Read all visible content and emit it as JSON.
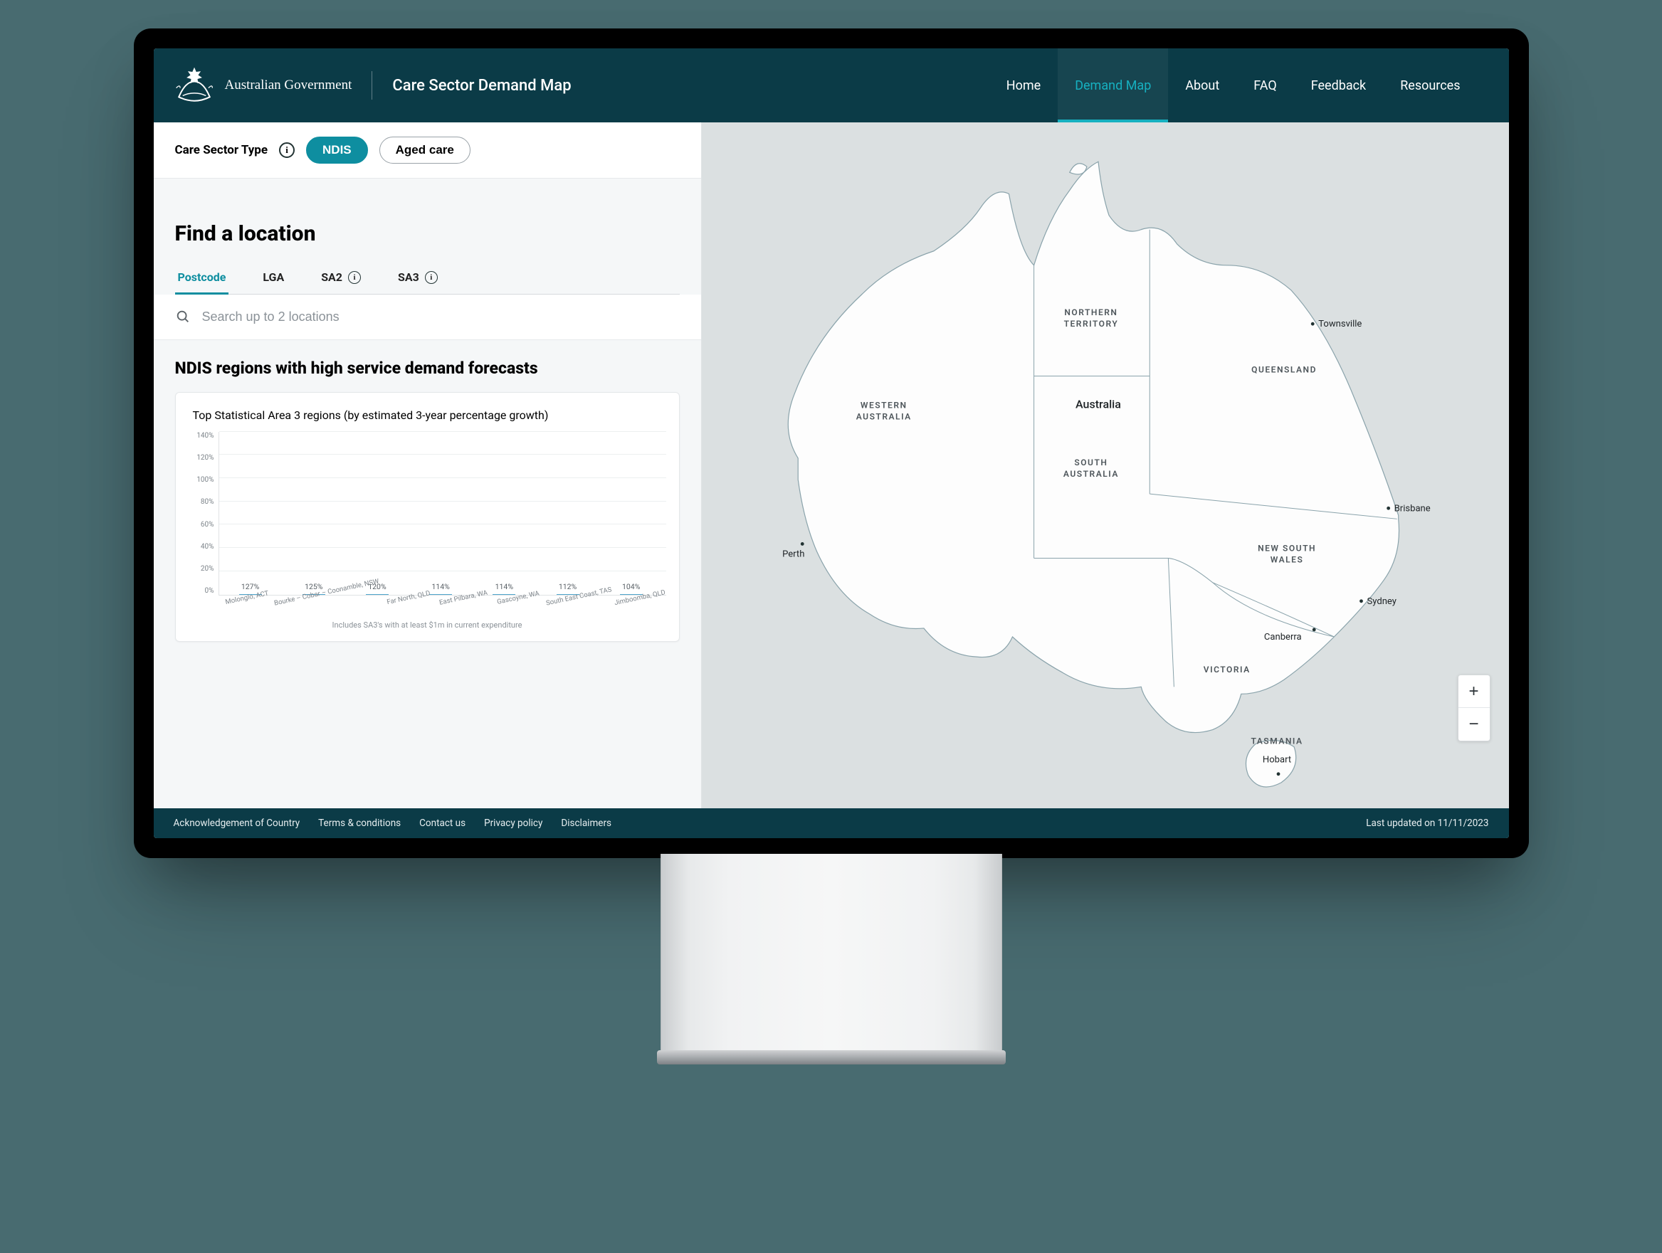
{
  "header": {
    "gov_label": "Australian Government",
    "app_title": "Care Sector Demand Map",
    "nav": [
      {
        "label": "Home",
        "active": false
      },
      {
        "label": "Demand Map",
        "active": true
      },
      {
        "label": "About",
        "active": false
      },
      {
        "label": "FAQ",
        "active": false
      },
      {
        "label": "Feedback",
        "active": false
      },
      {
        "label": "Resources",
        "active": false
      }
    ]
  },
  "sector": {
    "label": "Care Sector Type",
    "options": [
      {
        "label": "NDIS",
        "active": true
      },
      {
        "label": "Aged care",
        "active": false
      }
    ]
  },
  "find": {
    "heading": "Find a location",
    "tabs": [
      {
        "label": "Postcode",
        "info": false,
        "active": true
      },
      {
        "label": "LGA",
        "info": false,
        "active": false
      },
      {
        "label": "SA2",
        "info": true,
        "active": false
      },
      {
        "label": "SA3",
        "info": true,
        "active": false
      }
    ],
    "search_placeholder": "Search up to 2 locations"
  },
  "regions": {
    "heading": "NDIS regions with high service demand forecasts"
  },
  "chart_data": {
    "type": "bar",
    "title": "Top Statistical Area 3 regions (by estimated 3-year percentage growth)",
    "ylabel": "",
    "xlabel": "",
    "ylim": [
      0,
      140
    ],
    "yticks": [
      0,
      20,
      40,
      60,
      80,
      100,
      120,
      140
    ],
    "ytick_labels": [
      "0%",
      "20%",
      "40%",
      "60%",
      "80%",
      "100%",
      "120%",
      "140%"
    ],
    "categories": [
      "Molonglo, ACT",
      "Bourke – Cobar – Coonamble, NSW",
      "Far North, QLD",
      "East Pilbara, WA",
      "Gascoyne, WA",
      "South East Coast, TAS",
      "Jimboomba, QLD"
    ],
    "values": [
      127,
      125,
      120,
      114,
      114,
      112,
      104
    ],
    "value_labels": [
      "127%",
      "125%",
      "120%",
      "114%",
      "114%",
      "112%",
      "104%"
    ],
    "footnote": "Includes SA3's with at least $1m in current expenditure"
  },
  "map": {
    "center_label": "Australia",
    "states": [
      {
        "name": "WESTERN AUSTRALIA"
      },
      {
        "name": "NORTHERN TERRITORY"
      },
      {
        "name": "QUEENSLAND"
      },
      {
        "name": "SOUTH AUSTRALIA"
      },
      {
        "name": "NEW SOUTH WALES"
      },
      {
        "name": "VICTORIA"
      },
      {
        "name": "TASMANIA"
      }
    ],
    "cities": [
      {
        "name": "Perth"
      },
      {
        "name": "Townsville"
      },
      {
        "name": "Brisbane"
      },
      {
        "name": "Sydney"
      },
      {
        "name": "Canberra"
      },
      {
        "name": "Hobart"
      }
    ],
    "zoom_in": "+",
    "zoom_out": "−"
  },
  "footer": {
    "links": [
      "Acknowledgement of Country",
      "Terms & conditions",
      "Contact us",
      "Privacy policy",
      "Disclaimers"
    ],
    "last_updated": "Last updated on 11/11/2023"
  }
}
